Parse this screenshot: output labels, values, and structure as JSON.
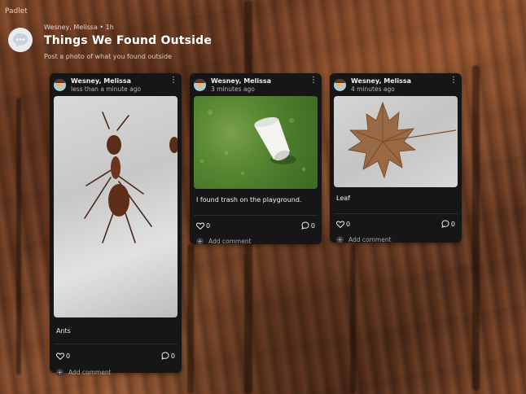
{
  "app": {
    "name": "Padlet"
  },
  "header": {
    "meta": "Wesney, Melissa • 1h",
    "title": "Things We Found Outside",
    "subtitle": "Post a photo of what you found outside"
  },
  "posts": [
    {
      "author": "Wesney, Melissa",
      "time": "less than a minute ago",
      "caption": "Ants",
      "likes": "0",
      "comments": "0",
      "add_comment": "Add comment",
      "image": "ant-photo"
    },
    {
      "author": "Wesney, Melissa",
      "time": "3 minutes ago",
      "caption": "I found trash on the playground.",
      "likes": "0",
      "comments": "0",
      "add_comment": "Add comment",
      "image": "cup-on-grass-photo"
    },
    {
      "author": "Wesney, Melissa",
      "time": "4 minutes ago",
      "caption": "Leaf",
      "likes": "0",
      "comments": "0",
      "add_comment": "Add comment",
      "image": "leaf-photo"
    }
  ],
  "icons": {
    "menu": "more-vertical-icon",
    "like": "heart-icon",
    "comment": "comment-icon",
    "add": "plus-icon",
    "board": "chat-bubble-icon"
  }
}
